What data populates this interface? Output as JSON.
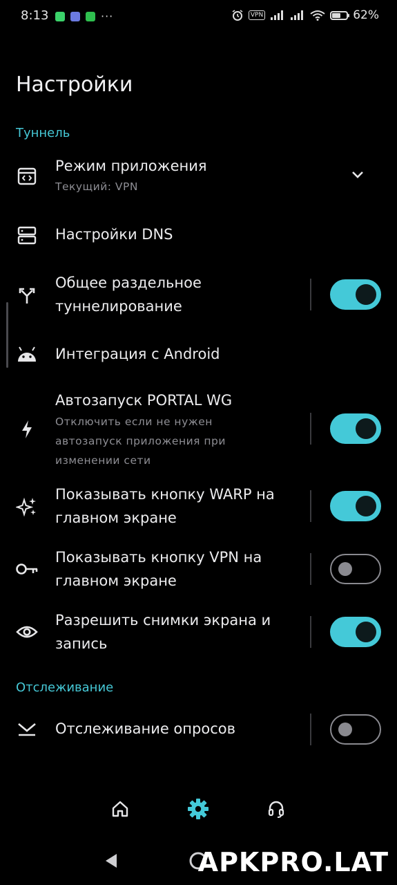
{
  "status_bar": {
    "time": "8:13",
    "dots": "···",
    "vpn_badge": "VPN",
    "battery_percent": "62%",
    "battery_level": 0.62
  },
  "page_title": "Настройки",
  "sections": {
    "tunnel": "Туннель",
    "tracking": "Отслеживание"
  },
  "items": {
    "app_mode": {
      "title": "Режим приложения",
      "subtitle": "Текущий: VPN"
    },
    "dns": {
      "title": "Настройки DNS"
    },
    "split_tunnel": {
      "title": "Общее раздельное туннелирование",
      "enabled": true
    },
    "android_integration": {
      "title": "Интеграция с Android"
    },
    "autostart": {
      "title": "Автозапуск PORTAL WG",
      "subtitle": "Отключить если не нужен автозапуск приложения при изменении сети",
      "enabled": true
    },
    "show_warp": {
      "title": "Показывать кнопку WARP на главном экране",
      "enabled": true
    },
    "show_vpn": {
      "title": "Показывать кнопку VPN на главном экране",
      "enabled": false
    },
    "screenshots": {
      "title": "Разрешить снимки экрана и запись",
      "enabled": true
    },
    "poll_tracking": {
      "title": "Отслеживание опросов",
      "enabled": false
    }
  },
  "icons": {
    "app_mode": "code-window-icon",
    "dns": "server-icon",
    "split_tunnel": "split-arrows-icon",
    "android_integration": "android-icon",
    "autostart": "bolt-icon",
    "show_warp": "sparkles-icon",
    "show_vpn": "key-icon",
    "screenshots": "eye-icon",
    "poll_tracking": "poll-tracking-icon"
  },
  "bottom_nav": [
    "home-icon",
    "gear-icon",
    "headset-icon"
  ],
  "watermark": "APKPRO.LAT",
  "colors": {
    "accent": "#44c9d8",
    "background": "#000000"
  }
}
